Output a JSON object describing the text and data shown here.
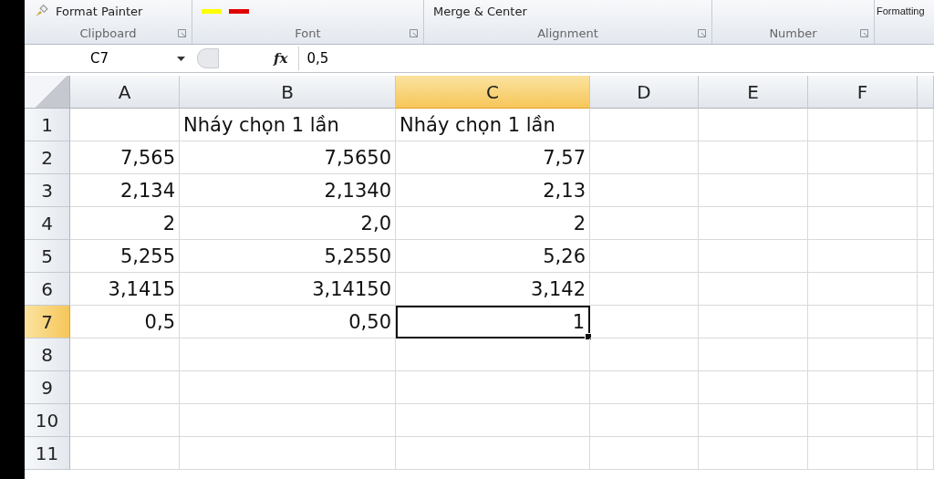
{
  "ribbon": {
    "groups": [
      {
        "label": "Clipboard",
        "items": [
          "Format Painter"
        ]
      },
      {
        "label": "Font"
      },
      {
        "label": "Alignment",
        "items": [
          "Merge & Center"
        ]
      },
      {
        "label": "Number"
      },
      {
        "items": [
          "Formatting"
        ]
      }
    ]
  },
  "formula_bar": {
    "name_box": "C7",
    "function_label": "fx",
    "value": "0,5"
  },
  "columns": [
    {
      "label": "A",
      "selected": false
    },
    {
      "label": "B",
      "selected": false
    },
    {
      "label": "C",
      "selected": true
    },
    {
      "label": "D",
      "selected": false
    },
    {
      "label": "E",
      "selected": false
    },
    {
      "label": "F",
      "selected": false
    }
  ],
  "rows": [
    {
      "header": "1",
      "selected": false,
      "cells": {
        "B": {
          "kind": "text",
          "text": "Nháy chọn 1 lần",
          "selected": false
        },
        "C": {
          "kind": "text",
          "text": "Nháy chọn 1 lần",
          "selected": false
        }
      }
    },
    {
      "header": "2",
      "selected": false,
      "cells": {
        "A": {
          "kind": "number",
          "text": "7,565",
          "selected": false
        },
        "B": {
          "kind": "number",
          "text": "7,5650",
          "selected": false
        },
        "C": {
          "kind": "number",
          "text": "7,57",
          "selected": false
        }
      }
    },
    {
      "header": "3",
      "selected": false,
      "cells": {
        "A": {
          "kind": "number",
          "text": "2,134",
          "selected": false
        },
        "B": {
          "kind": "number",
          "text": "2,1340",
          "selected": false
        },
        "C": {
          "kind": "number",
          "text": "2,13",
          "selected": false
        }
      }
    },
    {
      "header": "4",
      "selected": false,
      "cells": {
        "A": {
          "kind": "number",
          "text": "2",
          "selected": false
        },
        "B": {
          "kind": "number",
          "text": "2,0",
          "selected": false
        },
        "C": {
          "kind": "number",
          "text": "2",
          "selected": false
        }
      }
    },
    {
      "header": "5",
      "selected": false,
      "cells": {
        "A": {
          "kind": "number",
          "text": "5,255",
          "selected": false
        },
        "B": {
          "kind": "number",
          "text": "5,2550",
          "selected": false
        },
        "C": {
          "kind": "number",
          "text": "5,26",
          "selected": false
        }
      }
    },
    {
      "header": "6",
      "selected": false,
      "cells": {
        "A": {
          "kind": "number",
          "text": "3,1415",
          "selected": false
        },
        "B": {
          "kind": "number",
          "text": "3,14150",
          "selected": false
        },
        "C": {
          "kind": "number",
          "text": "3,142",
          "selected": false
        }
      }
    },
    {
      "header": "7",
      "selected": true,
      "cells": {
        "A": {
          "kind": "number",
          "text": "0,5",
          "selected": false
        },
        "B": {
          "kind": "number",
          "text": "0,50",
          "selected": false
        },
        "C": {
          "kind": "number",
          "text": "1",
          "selected": true
        }
      }
    },
    {
      "header": "8",
      "selected": false
    },
    {
      "header": "9",
      "selected": false
    },
    {
      "header": "10",
      "selected": false
    },
    {
      "header": "11",
      "selected": false
    }
  ]
}
